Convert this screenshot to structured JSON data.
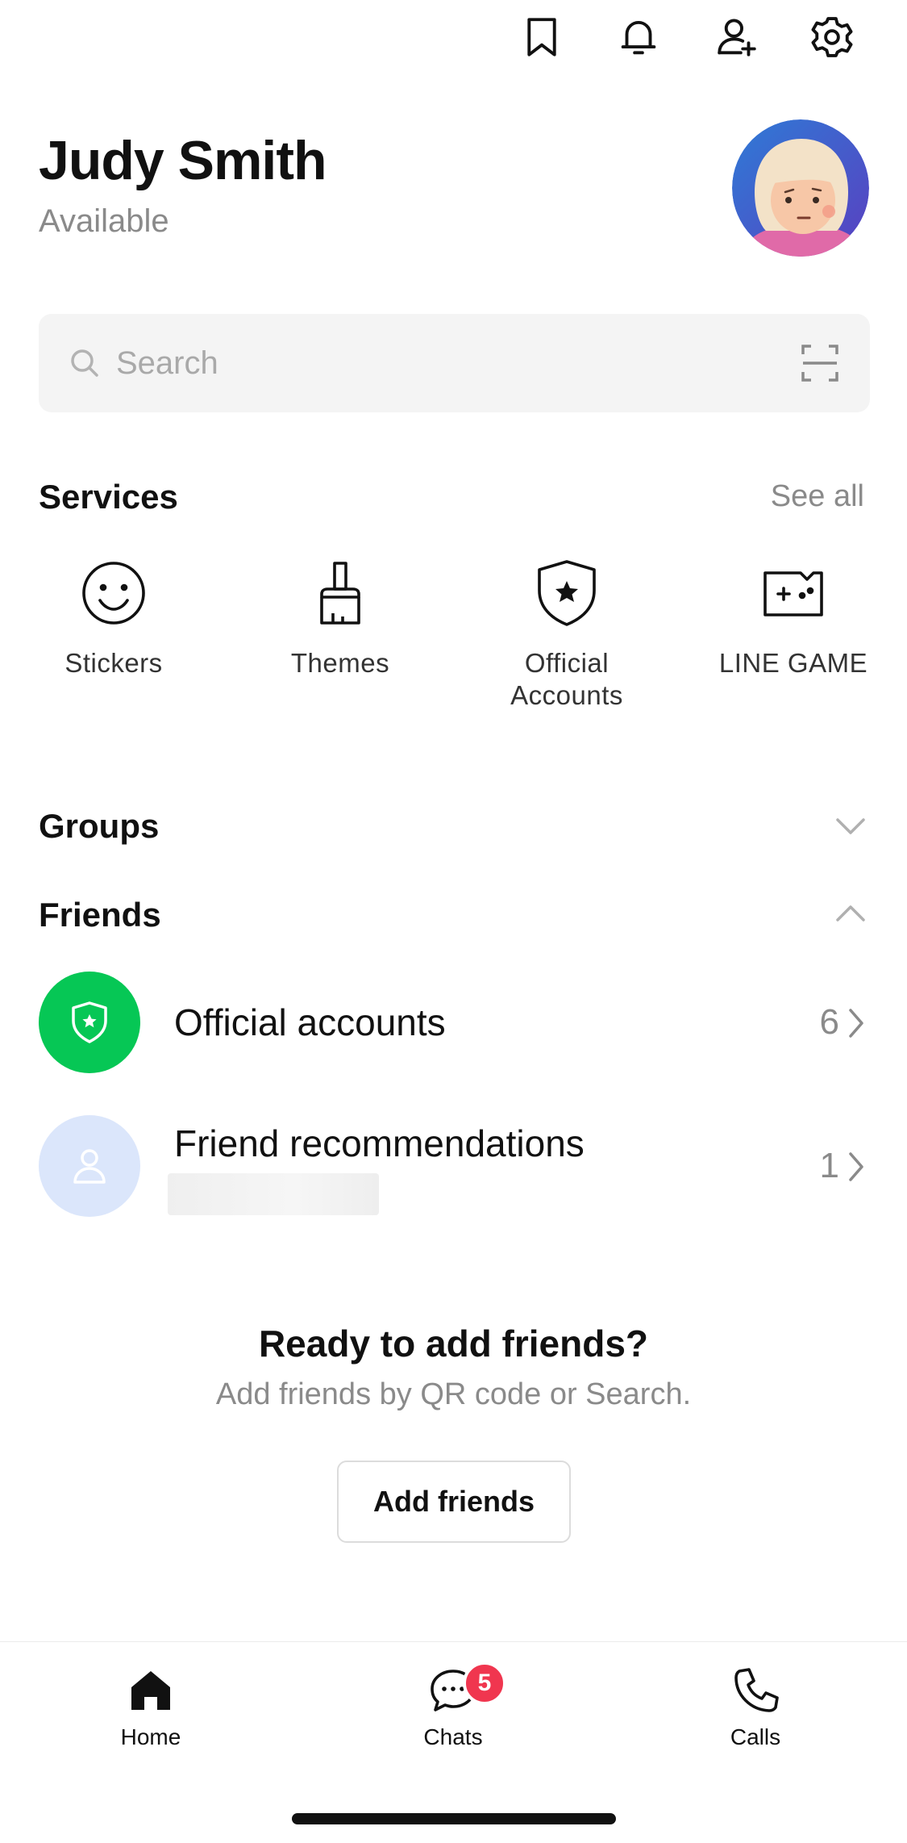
{
  "profile": {
    "name": "Judy Smith",
    "status": "Available"
  },
  "top_icons": [
    "bookmark-icon",
    "bell-icon",
    "add-friend-icon",
    "gear-icon"
  ],
  "search": {
    "placeholder": "Search",
    "value": ""
  },
  "services": {
    "title": "Services",
    "see_all": "See all",
    "items": [
      {
        "label": "Stickers",
        "icon": "smiley-icon"
      },
      {
        "label": "Themes",
        "icon": "brush-icon"
      },
      {
        "label": "Official\nAccounts",
        "icon": "shield-star-icon"
      },
      {
        "label": "LINE GAME",
        "icon": "game-icon"
      }
    ]
  },
  "groups": {
    "title": "Groups",
    "expanded": false
  },
  "friends": {
    "title": "Friends",
    "expanded": true,
    "rows": [
      {
        "label": "Official accounts",
        "count": "6",
        "icon": "shield-star-icon",
        "icon_bg": "#06c755"
      },
      {
        "label": "Friend recommendations",
        "count": "1",
        "icon": "person-icon",
        "icon_bg": "#dbe6fb"
      }
    ]
  },
  "empty_state": {
    "title": "Ready to add friends?",
    "subtitle": "Add friends by QR code or Search.",
    "button": "Add friends"
  },
  "tab_bar": {
    "tabs": [
      {
        "label": "Home",
        "icon": "home-icon",
        "active": true
      },
      {
        "label": "Chats",
        "icon": "chat-bubble-icon",
        "badge": "5"
      },
      {
        "label": "Calls",
        "icon": "phone-icon"
      }
    ]
  },
  "colors": {
    "accent_green": "#06c755",
    "badge_red": "#f0364f",
    "muted_text": "#8a8a8a"
  }
}
